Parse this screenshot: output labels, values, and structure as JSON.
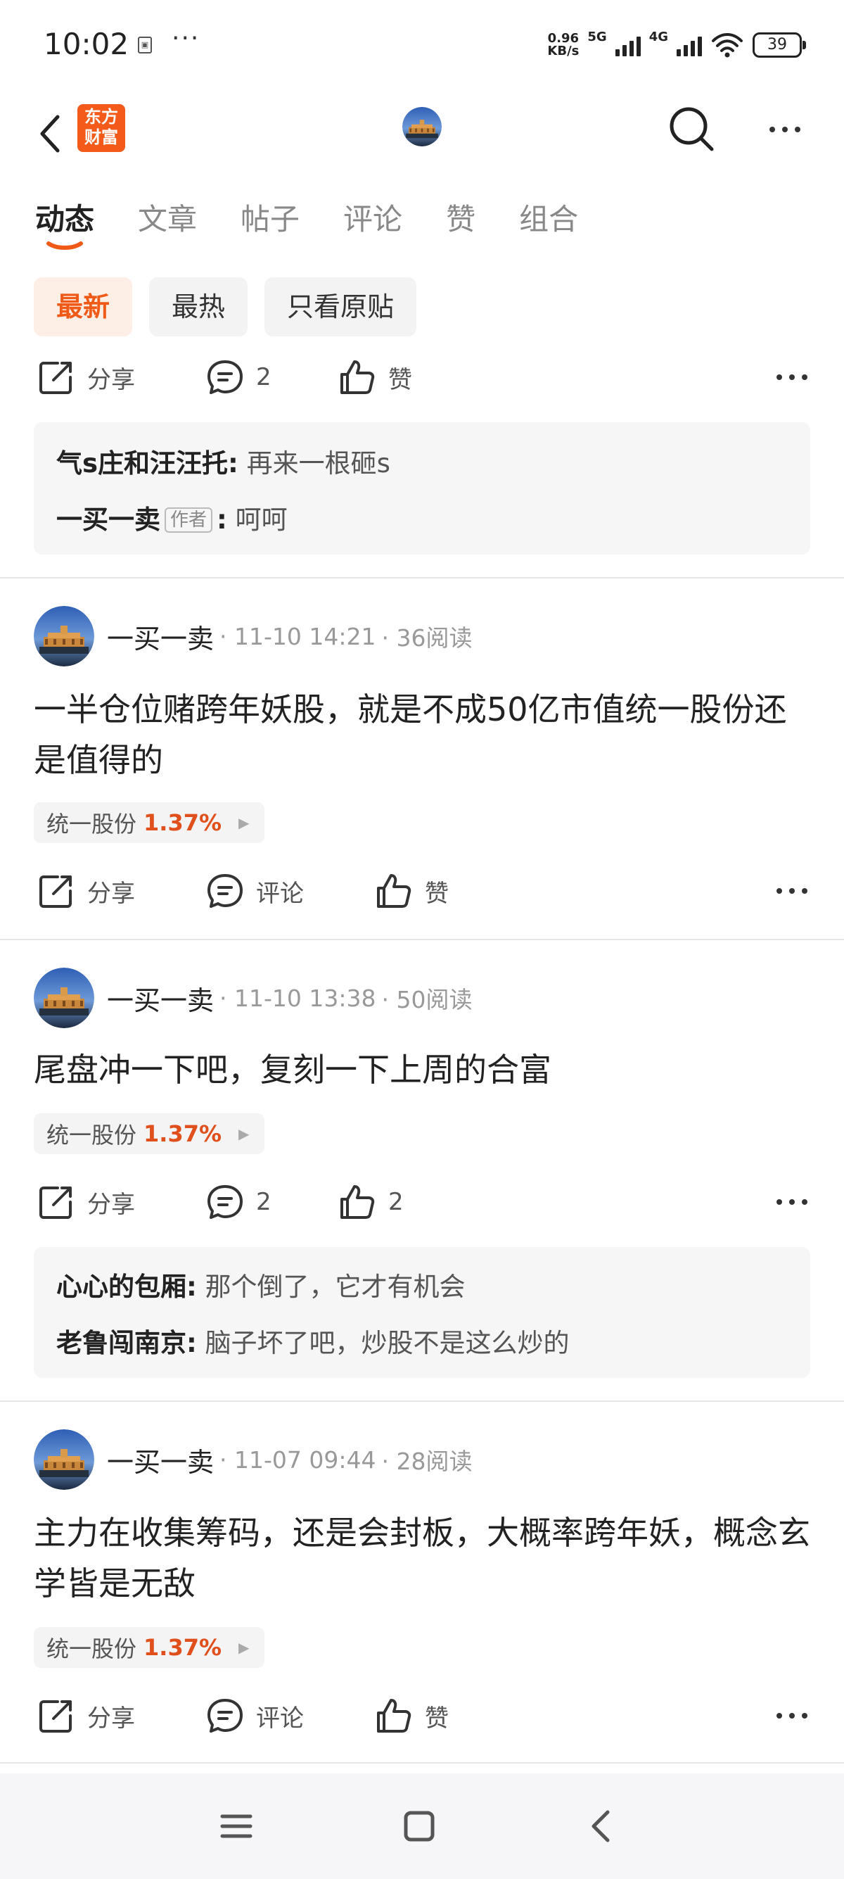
{
  "status": {
    "time": "10:02",
    "sim_icon": "sim-icon",
    "more": "···",
    "net_speed_value": "0.96",
    "net_speed_unit": "KB/s",
    "sig1": "5G",
    "sig2": "4G",
    "battery": "39"
  },
  "header": {
    "logo_text_1": "东方",
    "logo_text_2": "财富",
    "back_icon": "chevron-left-icon",
    "search_icon": "search-icon",
    "more_icon": "more-horizontal-icon"
  },
  "tabs": [
    {
      "label": "动态",
      "active": true
    },
    {
      "label": "文章"
    },
    {
      "label": "帖子"
    },
    {
      "label": "评论"
    },
    {
      "label": "赞"
    },
    {
      "label": "组合"
    }
  ],
  "filters": [
    {
      "label": "最新",
      "active": true
    },
    {
      "label": "最热"
    },
    {
      "label": "只看原贴"
    }
  ],
  "labels": {
    "share": "分享",
    "comment": "评论",
    "like": "赞",
    "author_tag": "作者"
  },
  "top_post": {
    "comment_count": "2",
    "comments": [
      {
        "user": "气s庄和汪汪托",
        "sep": ":",
        "text": "再来一根砸s"
      },
      {
        "user": "一买一卖",
        "author": true,
        "sep": ":",
        "text": "呵呵"
      }
    ]
  },
  "posts": [
    {
      "author": "一买一卖",
      "time": "· 11-10 14:21",
      "reads": "· 36阅读",
      "text": "一半仓位赌跨年妖股，就是不成50亿市值统一股份还是值得的",
      "stock_name": "统一股份",
      "stock_pct": "1.37%",
      "comment_label": "评论",
      "like_label": "赞"
    },
    {
      "author": "一买一卖",
      "time": "· 11-10 13:38",
      "reads": "· 50阅读",
      "text": "尾盘冲一下吧，复刻一下上周的合富",
      "stock_name": "统一股份",
      "stock_pct": "1.37%",
      "comment_label": "2",
      "like_label": "2",
      "comments": [
        {
          "user": "心心的包厢",
          "sep": ":",
          "text": "那个倒了，它才有机会"
        },
        {
          "user": "老鲁闯南京",
          "sep": ":",
          "text": "脑子坏了吧，炒股不是这么炒的"
        }
      ]
    },
    {
      "author": "一买一卖",
      "time": "· 11-07 09:44",
      "reads": "· 28阅读",
      "text": "主力在收集筹码，还是会封板，大概率跨年妖，概念玄学皆是无敌",
      "stock_name": "统一股份",
      "stock_pct": "1.37%",
      "comment_label": "评论",
      "like_label": "赞"
    }
  ],
  "colors": {
    "accent": "#ef5a19",
    "stock_up": "#e0501c"
  }
}
